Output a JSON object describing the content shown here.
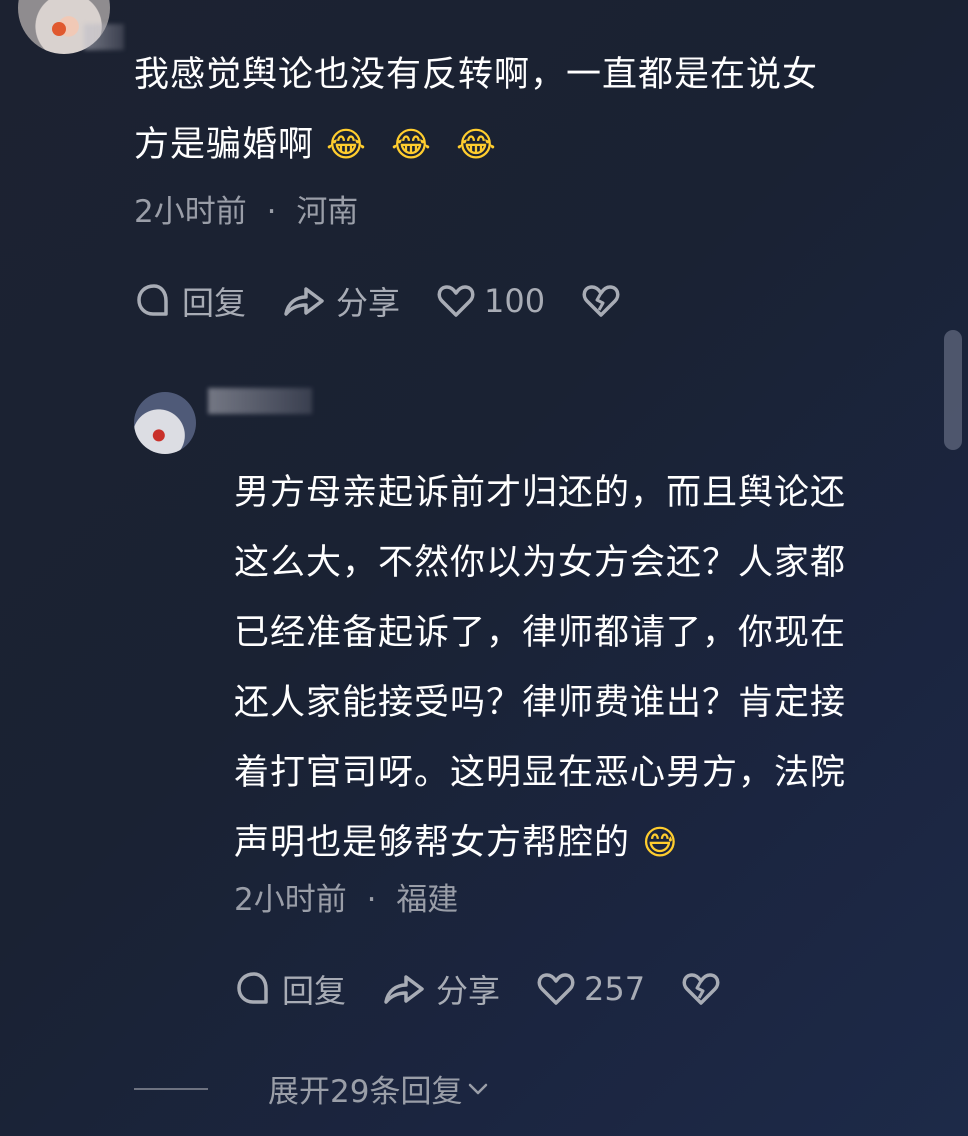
{
  "comments": [
    {
      "text": "我感觉舆论也没有反转啊，一直都是在说女\n方是骗婚啊",
      "emojis": [
        "😂",
        "😂",
        "😂"
      ],
      "time": "2小时前",
      "location": "河南",
      "actions": {
        "reply": "回复",
        "share": "分享",
        "likes": "100"
      }
    },
    {
      "text": "男方母亲起诉前才归还的，而且舆论还\n这么大，不然你以为女方会还？人家都\n已经准备起诉了，律师都请了，你现在\n还人家能接受吗？律师费谁出？肯定接\n着打官司呀。这明显在恶心男方，法院\n声明也是够帮女方帮腔的",
      "emojis": [
        "😅"
      ],
      "time": "2小时前",
      "location": "福建",
      "actions": {
        "reply": "回复",
        "share": "分享",
        "likes": "257"
      }
    }
  ],
  "separator": "·",
  "expand_label": "展开29条回复",
  "icons": {
    "reply": "comment-bubble-icon",
    "share": "share-arrow-icon",
    "like": "heart-icon",
    "dislike": "broken-heart-icon",
    "expand": "chevron-down-icon"
  },
  "colors": {
    "background": "#1b2336",
    "text": "#ffffff",
    "meta": "#9a9ea8"
  }
}
